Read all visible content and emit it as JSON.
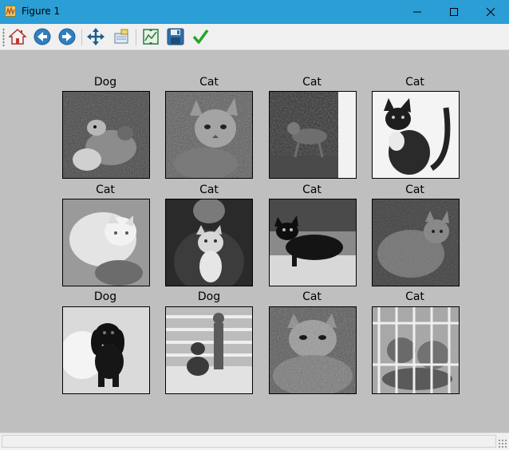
{
  "window": {
    "title": "Figure 1",
    "app_icon": "matplotlib-figure-icon"
  },
  "toolbar": {
    "buttons": [
      {
        "name": "home",
        "icon": "home-icon",
        "tooltip": "Home"
      },
      {
        "name": "back",
        "icon": "back-arrow-icon",
        "tooltip": "Back"
      },
      {
        "name": "forward",
        "icon": "forward-arrow-icon",
        "tooltip": "Forward"
      },
      {
        "name": "pan",
        "icon": "move-icon",
        "tooltip": "Pan"
      },
      {
        "name": "zoom",
        "icon": "zoom-rect-icon",
        "tooltip": "Zoom"
      },
      {
        "name": "subplots",
        "icon": "configure-subplots-icon",
        "tooltip": "Configure subplots"
      },
      {
        "name": "save",
        "icon": "floppy-disk-icon",
        "tooltip": "Save"
      },
      {
        "name": "check",
        "icon": "checkmark-icon",
        "tooltip": "Edit"
      }
    ]
  },
  "figure": {
    "grid": [
      [
        {
          "label": "Dog"
        },
        {
          "label": "Cat"
        },
        {
          "label": "Cat"
        },
        {
          "label": "Cat"
        }
      ],
      [
        {
          "label": "Cat"
        },
        {
          "label": "Cat"
        },
        {
          "label": "Cat"
        },
        {
          "label": "Cat"
        }
      ],
      [
        {
          "label": "Dog"
        },
        {
          "label": "Dog"
        },
        {
          "label": "Cat"
        },
        {
          "label": "Cat"
        }
      ]
    ],
    "colors": {
      "background": "#bfbfbf"
    }
  },
  "statusbar": {
    "message": ""
  }
}
